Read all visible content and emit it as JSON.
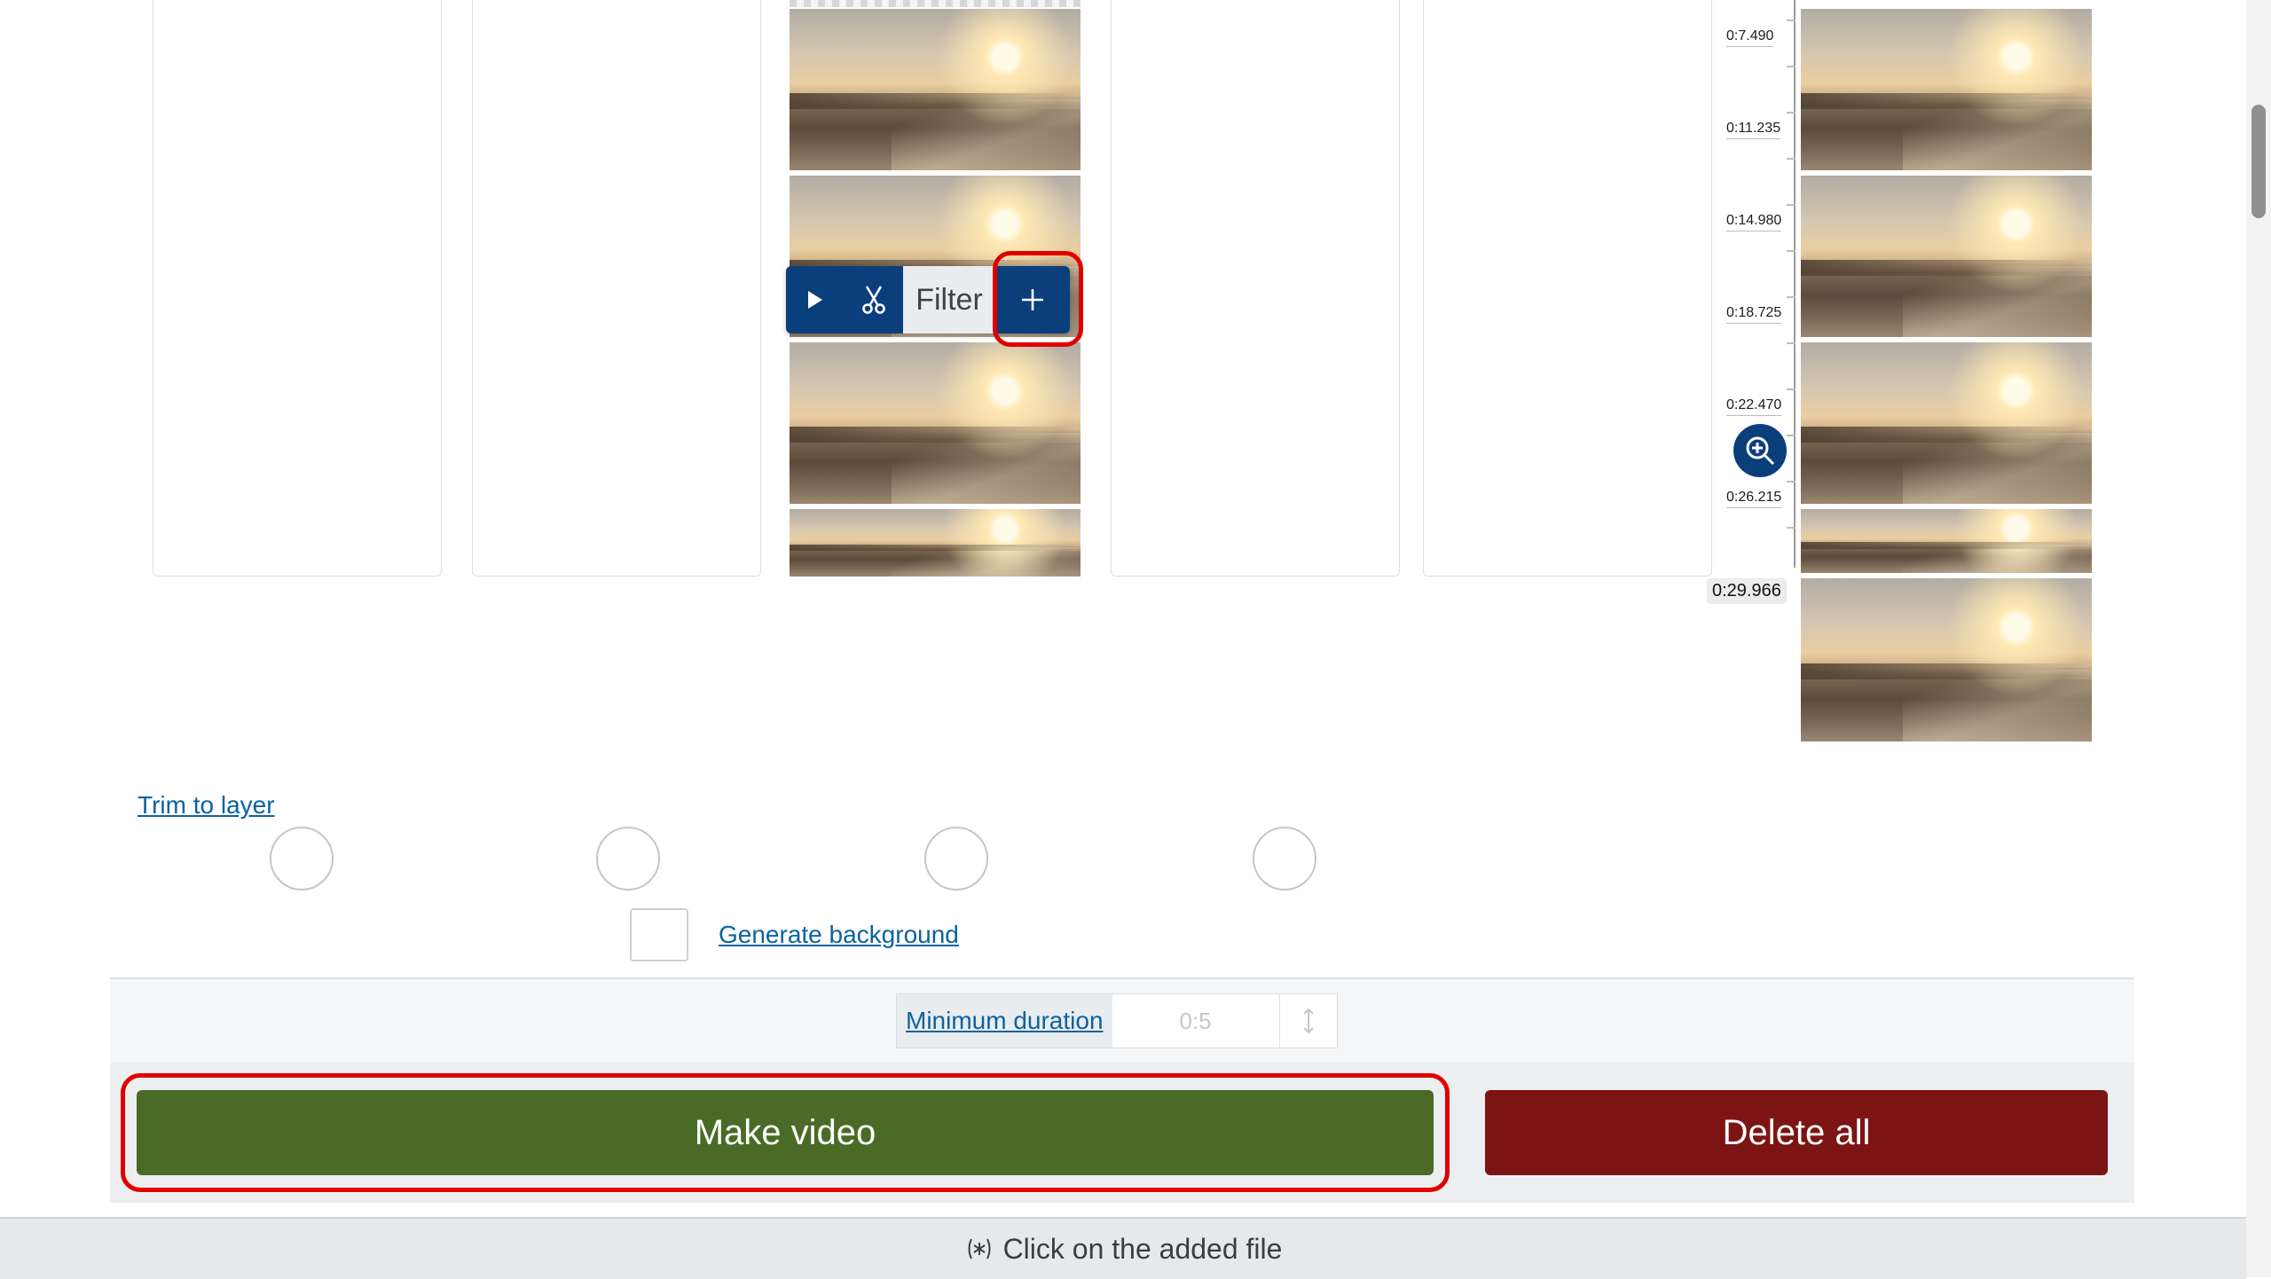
{
  "toolbar": {
    "play_icon": "play-icon",
    "cut_icon": "scissors-icon",
    "filter_label": "Filter",
    "add_icon": "plus-icon"
  },
  "timeline": {
    "labels": [
      "0:7.490",
      "0:11.235",
      "0:14.980",
      "0:18.725",
      "0:22.470",
      "0:26.215"
    ],
    "end_time": "0:29.966",
    "zoom_icon": "zoom-in-icon"
  },
  "controls": {
    "trim_to_layer": "Trim to layer",
    "generate_background": "Generate background",
    "minimum_duration_label": "Minimum duration",
    "minimum_duration_placeholder": "0:5",
    "spin_icon": "up-down-icon"
  },
  "actions": {
    "make_video": "Make video",
    "delete_all": "Delete all"
  },
  "status": {
    "icon": "tap-icon",
    "text": "Click on the added file"
  },
  "colors": {
    "accent_blue": "#0b3f7c",
    "make_green": "#4a6b26",
    "delete_red": "#7d1414",
    "highlight_red": "#e00000",
    "link_blue": "#0b62a0"
  }
}
